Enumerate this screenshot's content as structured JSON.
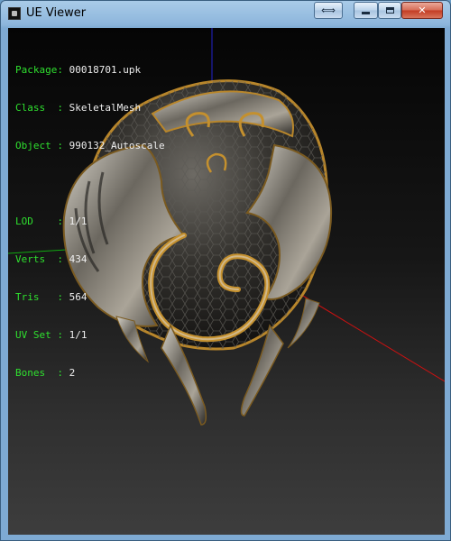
{
  "window": {
    "title": "UE Viewer",
    "icons": {
      "app": "ue-viewer-app-icon",
      "swap": "swap-arrows-icon",
      "minimize": "minimize-icon",
      "maximize": "maximize-icon",
      "close": "close-icon"
    },
    "swap_symbol": "⟺",
    "close_symbol": "✕"
  },
  "info": {
    "package": {
      "key": "Package",
      "value": "00018701.upk"
    },
    "class": {
      "key": "Class  ",
      "value": "SkeletalMesh"
    },
    "object": {
      "key": "Object ",
      "value": "990132_Autoscale"
    },
    "lod": {
      "key": "LOD    ",
      "value": "1/1"
    },
    "verts": {
      "key": "Verts  ",
      "value": "434"
    },
    "tris": {
      "key": "Tris   ",
      "value": "564"
    },
    "uvset": {
      "key": "UV Set ",
      "value": "1/1"
    },
    "bones": {
      "key": "Bones  ",
      "value": "2"
    }
  },
  "colors": {
    "label_green": "#2fe02f",
    "axis_x": "#cc1111",
    "axis_y": "#11aa11",
    "axis_z": "#2222cc",
    "gold": "#b8862b"
  }
}
